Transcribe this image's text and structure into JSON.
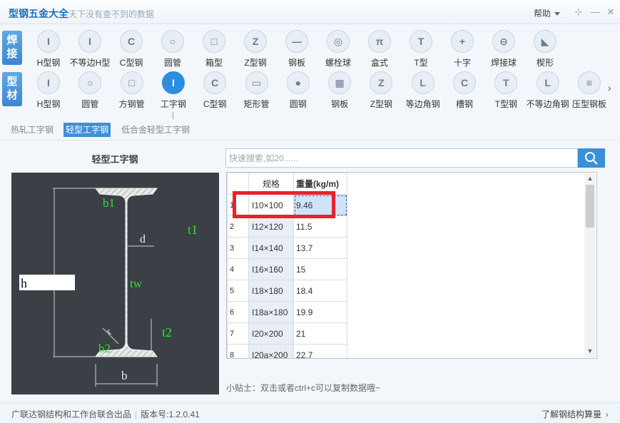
{
  "app": {
    "title": "型钢五金大全",
    "slogan": "天下没有查不到的数据",
    "help_label": "帮助",
    "window_buttons": [
      "pin-icon",
      "minimize-icon",
      "close-icon"
    ]
  },
  "toolbar": {
    "row1_tag": "焊接",
    "row1_items": [
      {
        "label": "H型钢",
        "glyph": "I"
      },
      {
        "label": "不等边H型",
        "glyph": "I"
      },
      {
        "label": "C型钢",
        "glyph": "C"
      },
      {
        "label": "圆管",
        "glyph": "○"
      },
      {
        "label": "箱型",
        "glyph": "□"
      },
      {
        "label": "Z型钢",
        "glyph": "Z"
      },
      {
        "label": "钢板",
        "glyph": "—"
      },
      {
        "label": "螺栓球",
        "glyph": "◎"
      },
      {
        "label": "盒式",
        "glyph": "π"
      },
      {
        "label": "T型",
        "glyph": "T"
      },
      {
        "label": "十字",
        "glyph": "+"
      },
      {
        "label": "焊接球",
        "glyph": "⊖"
      },
      {
        "label": "楔形",
        "glyph": "◣"
      }
    ],
    "row2_tag": "型材",
    "row2_items": [
      {
        "label": "H型钢",
        "glyph": "I"
      },
      {
        "label": "圆管",
        "glyph": "○"
      },
      {
        "label": "方钢管",
        "glyph": "□"
      },
      {
        "label": "工字钢",
        "glyph": "I"
      },
      {
        "label": "C型钢",
        "glyph": "C"
      },
      {
        "label": "矩形管",
        "glyph": "▭"
      },
      {
        "label": "圆钢",
        "glyph": "●"
      },
      {
        "label": "钢板",
        "glyph": "▦"
      },
      {
        "label": "Z型钢",
        "glyph": "Z"
      },
      {
        "label": "等边角钢",
        "glyph": "L"
      },
      {
        "label": "槽钢",
        "glyph": "C"
      },
      {
        "label": "T型钢",
        "glyph": "T"
      },
      {
        "label": "不等边角钢",
        "glyph": "L"
      },
      {
        "label": "压型钢板",
        "glyph": "≡"
      }
    ],
    "active_row2_item": "工字钢"
  },
  "subtabs": {
    "items": [
      "热轧工字钢",
      "轻型工字钢",
      "低合金轻型工字钢"
    ],
    "active": "轻型工字钢"
  },
  "diagram": {
    "title": "轻型工字钢",
    "labels": {
      "b1": "b1",
      "t1": "t1",
      "d": "d",
      "tw": "tw",
      "h": "h",
      "r": "r",
      "t2": "t2",
      "b2": "b2",
      "b": "b"
    }
  },
  "search": {
    "placeholder": "快速搜索,如20......",
    "value": ""
  },
  "table": {
    "columns": [
      "规格",
      "重量(kg/m)"
    ],
    "rows": [
      {
        "n": "1",
        "spec": "I10×100",
        "weight": "9.46"
      },
      {
        "n": "2",
        "spec": "I12×120",
        "weight": "11.5"
      },
      {
        "n": "3",
        "spec": "I14×140",
        "weight": "13.7"
      },
      {
        "n": "4",
        "spec": "I16×160",
        "weight": "15"
      },
      {
        "n": "5",
        "spec": "I18×180",
        "weight": "18.4"
      },
      {
        "n": "6",
        "spec": "I18a×180",
        "weight": "19.9"
      },
      {
        "n": "7",
        "spec": "I20×200",
        "weight": "21"
      },
      {
        "n": "8",
        "spec": "I20a×200",
        "weight": "22.7"
      }
    ],
    "selected_row": "1"
  },
  "tip": "小贴士：双击或者ctrl+c可以复制数据哦~",
  "footer": {
    "credit": "广联达钢结构和工作台联合出品",
    "version": "版本号:1.2.0.41",
    "link": "了解钢结构算量"
  },
  "colors": {
    "accent": "#3d8fd8",
    "highlight": "#e8212b",
    "diagram_bg": "#3b4047"
  }
}
